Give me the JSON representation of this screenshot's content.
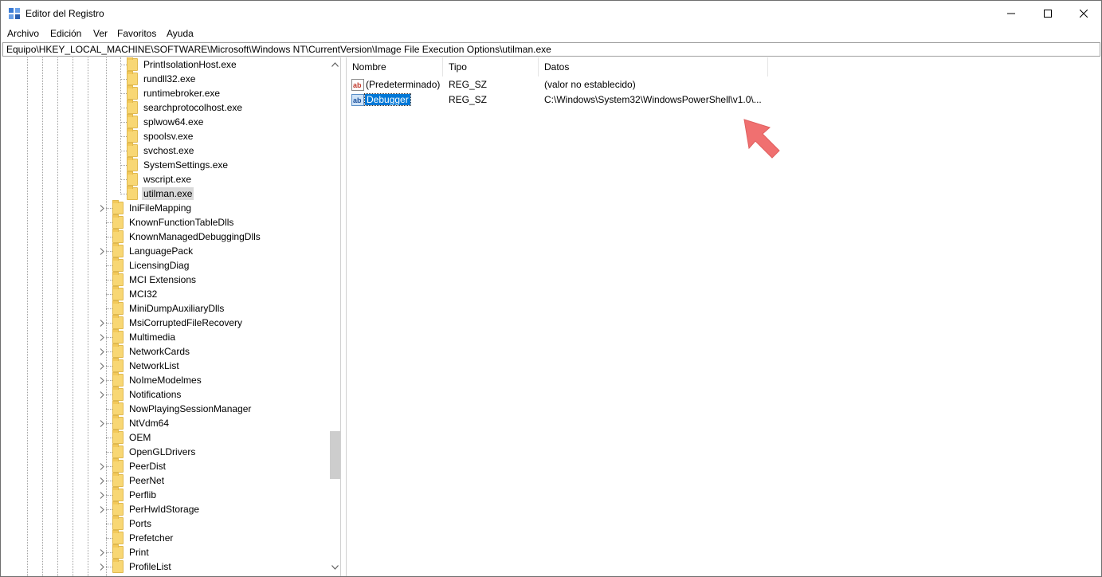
{
  "window": {
    "title": "Editor del Registro"
  },
  "menu": {
    "items": [
      "Archivo",
      "Edición",
      "Ver",
      "Favoritos",
      "Ayuda"
    ]
  },
  "address": {
    "path": "Equipo\\HKEY_LOCAL_MACHINE\\SOFTWARE\\Microsoft\\Windows NT\\CurrentVersion\\Image File Execution Options\\utilman.exe"
  },
  "tree": {
    "deep_items": [
      "PrintIsolationHost.exe",
      "rundll32.exe",
      "runtimebroker.exe",
      "searchprotocolhost.exe",
      "splwow64.exe",
      "spoolsv.exe",
      "svchost.exe",
      "SystemSettings.exe",
      "wscript.exe",
      "utilman.exe"
    ],
    "selected": "utilman.exe",
    "items": [
      {
        "label": "IniFileMapping",
        "expandable": true
      },
      {
        "label": "KnownFunctionTableDlls",
        "expandable": false
      },
      {
        "label": "KnownManagedDebuggingDlls",
        "expandable": false
      },
      {
        "label": "LanguagePack",
        "expandable": true
      },
      {
        "label": "LicensingDiag",
        "expandable": false
      },
      {
        "label": "MCI Extensions",
        "expandable": false
      },
      {
        "label": "MCI32",
        "expandable": false
      },
      {
        "label": "MiniDumpAuxiliaryDlls",
        "expandable": false
      },
      {
        "label": "MsiCorruptedFileRecovery",
        "expandable": true
      },
      {
        "label": "Multimedia",
        "expandable": true
      },
      {
        "label": "NetworkCards",
        "expandable": true
      },
      {
        "label": "NetworkList",
        "expandable": true
      },
      {
        "label": "NoImeModelmes",
        "expandable": true
      },
      {
        "label": "Notifications",
        "expandable": true
      },
      {
        "label": "NowPlayingSessionManager",
        "expandable": false
      },
      {
        "label": "NtVdm64",
        "expandable": true
      },
      {
        "label": "OEM",
        "expandable": false
      },
      {
        "label": "OpenGLDrivers",
        "expandable": false
      },
      {
        "label": "PeerDist",
        "expandable": true
      },
      {
        "label": "PeerNet",
        "expandable": true
      },
      {
        "label": "Perflib",
        "expandable": true
      },
      {
        "label": "PerHwIdStorage",
        "expandable": true
      },
      {
        "label": "Ports",
        "expandable": false
      },
      {
        "label": "Prefetcher",
        "expandable": false
      },
      {
        "label": "Print",
        "expandable": true
      },
      {
        "label": "ProfileList",
        "expandable": true
      }
    ]
  },
  "list": {
    "columns": [
      "Nombre",
      "Tipo",
      "Datos"
    ],
    "rows": [
      {
        "name": "(Predeterminado)",
        "type": "REG_SZ",
        "data": "(valor no establecido)",
        "selected": false
      },
      {
        "name": "Debugger",
        "type": "REG_SZ",
        "data": "C:\\Windows\\System32\\WindowsPowerShell\\v1.0\\...",
        "selected": true
      }
    ]
  },
  "icons": {
    "app": "registry-editor-icon",
    "folder": "folder-icon",
    "string_value": "reg-sz-icon",
    "expand": "chevron-right-icon",
    "annotation": "arrow-icon"
  },
  "colors": {
    "selection": "#0078d7",
    "tree_selection": "#d9d9d9",
    "folder": "#f8d774",
    "annotation_arrow": "#f07070"
  }
}
